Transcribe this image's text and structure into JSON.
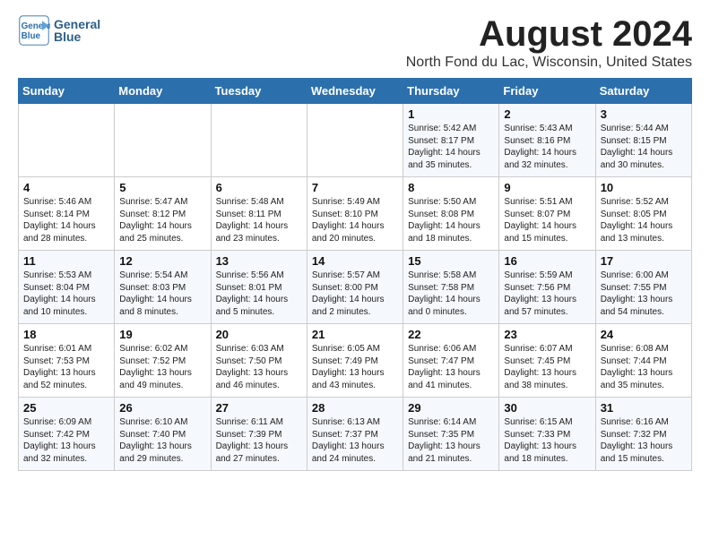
{
  "header": {
    "logo_line1": "General",
    "logo_line2": "Blue",
    "month_year": "August 2024",
    "location": "North Fond du Lac, Wisconsin, United States"
  },
  "weekdays": [
    "Sunday",
    "Monday",
    "Tuesday",
    "Wednesday",
    "Thursday",
    "Friday",
    "Saturday"
  ],
  "weeks": [
    [
      {
        "day": "",
        "content": ""
      },
      {
        "day": "",
        "content": ""
      },
      {
        "day": "",
        "content": ""
      },
      {
        "day": "",
        "content": ""
      },
      {
        "day": "1",
        "content": "Sunrise: 5:42 AM\nSunset: 8:17 PM\nDaylight: 14 hours\nand 35 minutes."
      },
      {
        "day": "2",
        "content": "Sunrise: 5:43 AM\nSunset: 8:16 PM\nDaylight: 14 hours\nand 32 minutes."
      },
      {
        "day": "3",
        "content": "Sunrise: 5:44 AM\nSunset: 8:15 PM\nDaylight: 14 hours\nand 30 minutes."
      }
    ],
    [
      {
        "day": "4",
        "content": "Sunrise: 5:46 AM\nSunset: 8:14 PM\nDaylight: 14 hours\nand 28 minutes."
      },
      {
        "day": "5",
        "content": "Sunrise: 5:47 AM\nSunset: 8:12 PM\nDaylight: 14 hours\nand 25 minutes."
      },
      {
        "day": "6",
        "content": "Sunrise: 5:48 AM\nSunset: 8:11 PM\nDaylight: 14 hours\nand 23 minutes."
      },
      {
        "day": "7",
        "content": "Sunrise: 5:49 AM\nSunset: 8:10 PM\nDaylight: 14 hours\nand 20 minutes."
      },
      {
        "day": "8",
        "content": "Sunrise: 5:50 AM\nSunset: 8:08 PM\nDaylight: 14 hours\nand 18 minutes."
      },
      {
        "day": "9",
        "content": "Sunrise: 5:51 AM\nSunset: 8:07 PM\nDaylight: 14 hours\nand 15 minutes."
      },
      {
        "day": "10",
        "content": "Sunrise: 5:52 AM\nSunset: 8:05 PM\nDaylight: 14 hours\nand 13 minutes."
      }
    ],
    [
      {
        "day": "11",
        "content": "Sunrise: 5:53 AM\nSunset: 8:04 PM\nDaylight: 14 hours\nand 10 minutes."
      },
      {
        "day": "12",
        "content": "Sunrise: 5:54 AM\nSunset: 8:03 PM\nDaylight: 14 hours\nand 8 minutes."
      },
      {
        "day": "13",
        "content": "Sunrise: 5:56 AM\nSunset: 8:01 PM\nDaylight: 14 hours\nand 5 minutes."
      },
      {
        "day": "14",
        "content": "Sunrise: 5:57 AM\nSunset: 8:00 PM\nDaylight: 14 hours\nand 2 minutes."
      },
      {
        "day": "15",
        "content": "Sunrise: 5:58 AM\nSunset: 7:58 PM\nDaylight: 14 hours\nand 0 minutes."
      },
      {
        "day": "16",
        "content": "Sunrise: 5:59 AM\nSunset: 7:56 PM\nDaylight: 13 hours\nand 57 minutes."
      },
      {
        "day": "17",
        "content": "Sunrise: 6:00 AM\nSunset: 7:55 PM\nDaylight: 13 hours\nand 54 minutes."
      }
    ],
    [
      {
        "day": "18",
        "content": "Sunrise: 6:01 AM\nSunset: 7:53 PM\nDaylight: 13 hours\nand 52 minutes."
      },
      {
        "day": "19",
        "content": "Sunrise: 6:02 AM\nSunset: 7:52 PM\nDaylight: 13 hours\nand 49 minutes."
      },
      {
        "day": "20",
        "content": "Sunrise: 6:03 AM\nSunset: 7:50 PM\nDaylight: 13 hours\nand 46 minutes."
      },
      {
        "day": "21",
        "content": "Sunrise: 6:05 AM\nSunset: 7:49 PM\nDaylight: 13 hours\nand 43 minutes."
      },
      {
        "day": "22",
        "content": "Sunrise: 6:06 AM\nSunset: 7:47 PM\nDaylight: 13 hours\nand 41 minutes."
      },
      {
        "day": "23",
        "content": "Sunrise: 6:07 AM\nSunset: 7:45 PM\nDaylight: 13 hours\nand 38 minutes."
      },
      {
        "day": "24",
        "content": "Sunrise: 6:08 AM\nSunset: 7:44 PM\nDaylight: 13 hours\nand 35 minutes."
      }
    ],
    [
      {
        "day": "25",
        "content": "Sunrise: 6:09 AM\nSunset: 7:42 PM\nDaylight: 13 hours\nand 32 minutes."
      },
      {
        "day": "26",
        "content": "Sunrise: 6:10 AM\nSunset: 7:40 PM\nDaylight: 13 hours\nand 29 minutes."
      },
      {
        "day": "27",
        "content": "Sunrise: 6:11 AM\nSunset: 7:39 PM\nDaylight: 13 hours\nand 27 minutes."
      },
      {
        "day": "28",
        "content": "Sunrise: 6:13 AM\nSunset: 7:37 PM\nDaylight: 13 hours\nand 24 minutes."
      },
      {
        "day": "29",
        "content": "Sunrise: 6:14 AM\nSunset: 7:35 PM\nDaylight: 13 hours\nand 21 minutes."
      },
      {
        "day": "30",
        "content": "Sunrise: 6:15 AM\nSunset: 7:33 PM\nDaylight: 13 hours\nand 18 minutes."
      },
      {
        "day": "31",
        "content": "Sunrise: 6:16 AM\nSunset: 7:32 PM\nDaylight: 13 hours\nand 15 minutes."
      }
    ]
  ]
}
